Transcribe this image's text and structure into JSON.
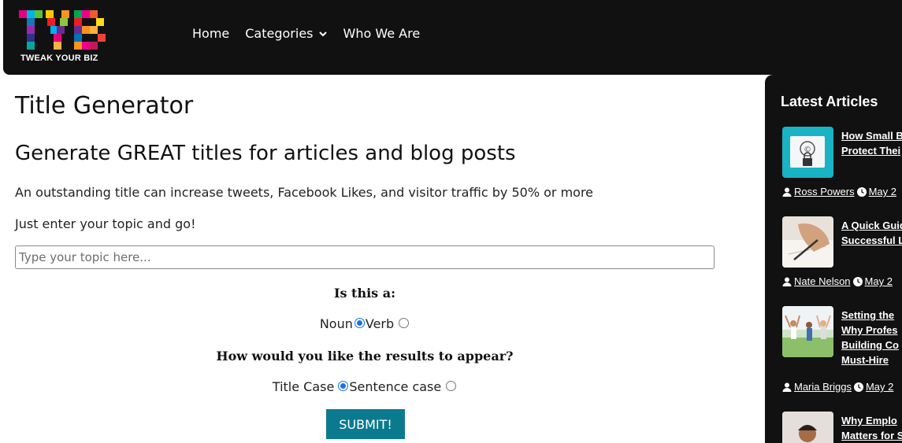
{
  "header": {
    "logo_text": "TWEAK YOUR BIZ",
    "logo_mark": "TYB",
    "nav": [
      {
        "label": "Home"
      },
      {
        "label": "Categories"
      },
      {
        "label": "Who We Are"
      }
    ]
  },
  "main": {
    "title": "Title Generator",
    "subtitle": "Generate GREAT titles for articles and blog posts",
    "description": "An outstanding title can increase tweets, Facebook Likes, and visitor traffic by 50% or more",
    "instruction": "Just enter your topic and go!",
    "topic_input": {
      "placeholder": "Type your topic here...",
      "value": ""
    },
    "question1": {
      "label": "Is this a:",
      "options": [
        {
          "label": "Noun",
          "checked": true
        },
        {
          "label": "Verb",
          "checked": false
        }
      ]
    },
    "question2": {
      "label": "How would you like the results to appear?",
      "options": [
        {
          "label": "Title Case",
          "checked": true
        },
        {
          "label": "Sentence case",
          "checked": false
        }
      ]
    },
    "submit_label": "SUBMIT!"
  },
  "sidebar": {
    "title": "Latest Articles",
    "articles": [
      {
        "title": "How Small B\nProtect Thei",
        "author": "Ross Powers",
        "date": "May 2"
      },
      {
        "title": "A Quick Guid\nSuccessful L",
        "author": "Nate Nelson",
        "date": "May 2"
      },
      {
        "title": "Setting the\nWhy Profes\nBuilding Co\nMust-Hire",
        "author": "Maria Briggs",
        "date": "May 2"
      },
      {
        "title": "Why Emplo\nMatters for S",
        "author": "",
        "date": ""
      }
    ]
  },
  "colors": {
    "header_bg": "#111111",
    "sidebar_bg": "#111111",
    "submit_bg": "#0b7a8f",
    "radio_accent": "#1a73e8"
  }
}
